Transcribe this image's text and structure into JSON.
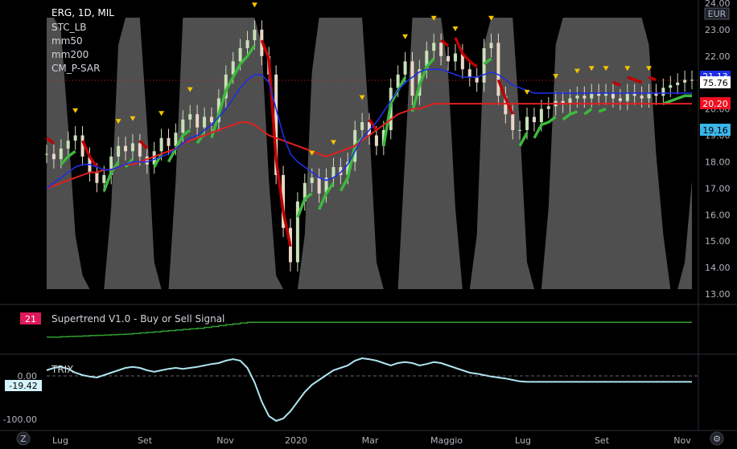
{
  "header": {
    "symbol": "ERG, 1D, MIL",
    "indicators": [
      "STC_LB",
      "mm50",
      "mm200",
      "CM_P-SAR"
    ],
    "currency": "EUR"
  },
  "badges": {
    "price_blue": "21.13",
    "price_white": "75.76",
    "price_red": "20.20",
    "price_cyan": "19.16",
    "supertrend_value": "21",
    "trix_value": "-19.42"
  },
  "colors": {
    "background": "#000000",
    "stc_fill": "#5d5d5d",
    "mm50": "#1e2ee6",
    "mm200": "#e02020",
    "sar_red": "#c00000",
    "sar_green": "#3db83d",
    "supertrend_green": "#2e9e2e",
    "supertrend_red": "#d0205a",
    "trix": "#aee4f0",
    "triangle": "#f5c400"
  },
  "chart_data": [
    {
      "type": "line",
      "panel": "price",
      "y_ticks": [
        "24.00",
        "23.00",
        "22.00",
        "21.00",
        "20.00",
        "19.00",
        "18.00",
        "17.00",
        "16.00",
        "15.00",
        "14.00",
        "13.00"
      ],
      "ylim": [
        13,
        24
      ],
      "x_ticks": [
        "Lug",
        "Set",
        "Nov",
        "2020",
        "Mar",
        "Maggio",
        "Lug",
        "Set",
        "Nov"
      ],
      "series": [
        {
          "key": "close",
          "x": [
            0,
            4,
            8,
            12,
            16,
            20,
            24,
            28,
            32,
            36,
            40,
            44,
            48,
            52,
            56,
            60,
            64,
            68,
            72,
            76,
            80,
            84,
            88,
            92,
            96,
            100,
            104,
            108,
            112,
            116,
            120,
            124,
            128,
            132,
            136,
            140,
            144,
            148,
            152,
            156,
            160,
            164,
            168,
            172,
            176,
            180,
            184,
            188,
            192,
            196,
            200,
            204,
            208,
            212,
            216,
            220,
            224,
            228,
            232,
            236,
            240,
            244,
            248,
            252,
            256,
            260,
            264,
            268,
            272,
            276,
            280,
            284,
            288,
            292,
            296,
            300,
            304,
            308,
            312,
            316,
            320,
            324,
            328,
            332,
            336,
            340,
            344,
            348,
            352,
            356,
            360
          ],
          "values": [
            18.3,
            18.1,
            18.5,
            18.8,
            19.0,
            18.2,
            17.6,
            17.2,
            17.5,
            18.2,
            18.6,
            18.4,
            18.7,
            18.2,
            17.9,
            18.4,
            18.9,
            18.6,
            19.1,
            19.6,
            19.8,
            19.3,
            19.7,
            19.5,
            20.4,
            21.3,
            21.8,
            22.3,
            22.6,
            23.0,
            22.0,
            21.3,
            17.5,
            15.5,
            14.2,
            16.5,
            17.2,
            17.4,
            16.8,
            17.4,
            17.8,
            17.5,
            18.0,
            19.2,
            19.5,
            19.0,
            18.6,
            19.2,
            20.8,
            21.3,
            21.8,
            20.5,
            21.5,
            22.2,
            22.5,
            22.0,
            21.8,
            22.1,
            21.5,
            21.2,
            21.0,
            22.3,
            22.5,
            20.5,
            19.8,
            19.2,
            19.2,
            19.7,
            19.5,
            20.0,
            20.1,
            20.3,
            20.2,
            20.4,
            20.5,
            20.4,
            20.6,
            20.5,
            20.6,
            20.4,
            20.3,
            20.6,
            20.5,
            20.4,
            20.6,
            20.5,
            20.8,
            20.9,
            21.0,
            21.1,
            21.1
          ]
        },
        {
          "key": "mm50",
          "name": "mm50",
          "values": [
            17.0,
            17.2,
            17.4,
            17.6,
            17.8,
            17.9,
            17.9,
            17.8,
            17.7,
            17.7,
            17.8,
            17.9,
            18.0,
            18.0,
            18.0,
            18.1,
            18.2,
            18.3,
            18.5,
            18.7,
            18.9,
            19.0,
            19.2,
            19.4,
            19.7,
            20.0,
            20.4,
            20.8,
            21.1,
            21.3,
            21.3,
            21.0,
            20.0,
            19.0,
            18.3,
            18.0,
            17.8,
            17.6,
            17.4,
            17.3,
            17.4,
            17.6,
            17.9,
            18.4,
            18.9,
            19.2,
            19.5,
            19.9,
            20.3,
            20.7,
            21.0,
            21.2,
            21.4,
            21.5,
            21.5,
            21.5,
            21.4,
            21.3,
            21.2,
            21.2,
            21.2,
            21.3,
            21.4,
            21.3,
            21.1,
            20.9,
            20.8,
            20.7,
            20.6,
            20.6,
            20.6,
            20.6,
            20.6,
            20.6,
            20.6,
            20.6,
            20.6,
            20.6,
            20.6,
            20.6,
            20.6,
            20.6,
            20.6,
            20.6,
            20.6,
            20.6,
            20.6,
            20.6,
            20.6,
            20.6,
            20.6
          ]
        },
        {
          "key": "mm200",
          "name": "mm200",
          "values": [
            17.0,
            17.1,
            17.2,
            17.3,
            17.4,
            17.5,
            17.6,
            17.6,
            17.7,
            17.7,
            17.8,
            17.9,
            17.9,
            18.0,
            18.1,
            18.2,
            18.3,
            18.4,
            18.5,
            18.7,
            18.8,
            18.9,
            19.0,
            19.1,
            19.2,
            19.3,
            19.4,
            19.5,
            19.5,
            19.4,
            19.2,
            19.0,
            18.9,
            18.8,
            18.7,
            18.6,
            18.5,
            18.4,
            18.3,
            18.2,
            18.3,
            18.4,
            18.5,
            18.6,
            18.8,
            19.0,
            19.2,
            19.4,
            19.6,
            19.8,
            19.9,
            20.0,
            20.0,
            20.1,
            20.2,
            20.2,
            20.2,
            20.2,
            20.2,
            20.2,
            20.2,
            20.2,
            20.2,
            20.2,
            20.2,
            20.2,
            20.2,
            20.2,
            20.2,
            20.2,
            20.2,
            20.2,
            20.2,
            20.2,
            20.2,
            20.2,
            20.2,
            20.2,
            20.2,
            20.2,
            20.2,
            20.2,
            20.2,
            20.2,
            20.2,
            20.2,
            20.2,
            20.2,
            20.2,
            20.2,
            20.2
          ]
        },
        {
          "key": "stc",
          "name": "STC_LB",
          "values": [
            100,
            100,
            95,
            60,
            20,
            5,
            0,
            0,
            0,
            30,
            90,
            100,
            100,
            100,
            60,
            10,
            0,
            0,
            40,
            100,
            100,
            100,
            100,
            100,
            100,
            100,
            100,
            100,
            100,
            100,
            90,
            40,
            5,
            0,
            0,
            0,
            20,
            80,
            100,
            100,
            100,
            100,
            100,
            100,
            100,
            60,
            10,
            0,
            0,
            0,
            50,
            100,
            100,
            100,
            100,
            100,
            80,
            30,
            0,
            0,
            20,
            90,
            100,
            100,
            100,
            100,
            60,
            10,
            0,
            0,
            30,
            90,
            100,
            100,
            100,
            100,
            100,
            100,
            100,
            100,
            100,
            100,
            100,
            100,
            90,
            50,
            20,
            0,
            0,
            10,
            40
          ]
        }
      ]
    },
    {
      "type": "line",
      "panel": "supertrend",
      "label": "Supertrend V1.0 - Buy or Sell Signal",
      "series": [
        {
          "key": "st",
          "values": [
            20.0,
            20.0,
            20.1,
            20.2,
            20.3,
            20.4,
            20.5,
            20.6,
            20.7,
            20.8,
            20.9,
            21.0,
            21.2,
            21.4,
            21.6,
            21.8,
            22.0,
            22.2,
            22.4,
            22.6,
            22.8,
            23.0,
            23.3,
            23.6,
            23.9,
            24.2,
            24.5,
            24.8,
            25.0,
            25.0,
            25.0,
            25.0,
            25.0,
            25.0,
            25.0,
            25.0,
            25.0,
            25.0,
            25.0,
            25.0,
            25.0,
            25.0,
            25.0,
            25.0,
            25.0,
            25.0,
            25.0,
            25.0,
            25.0,
            25.0,
            25.0,
            25.0,
            25.0,
            25.0,
            25.0,
            25.0,
            25.0,
            25.0,
            25.0,
            25.0,
            25.0,
            25.0,
            25.0,
            25.0,
            25.0,
            25.0,
            25.0,
            25.0,
            25.0,
            25.0,
            25.0,
            25.0,
            25.0,
            25.0,
            25.0,
            25.0,
            25.0,
            25.0,
            25.0,
            25.0,
            25.0,
            25.0,
            25.0,
            25.0,
            25.0,
            25.0,
            25.0,
            25.0,
            25.0,
            25.0,
            25.0
          ]
        }
      ]
    },
    {
      "type": "line",
      "panel": "trix",
      "label": "TRIX",
      "y_ticks": [
        "0.00",
        "-100.00"
      ],
      "ylim": [
        -110,
        30
      ],
      "series": [
        {
          "key": "trix",
          "values": [
            5,
            10,
            12,
            8,
            0,
            -5,
            -8,
            -10,
            -5,
            0,
            5,
            10,
            12,
            10,
            5,
            2,
            5,
            8,
            10,
            8,
            10,
            12,
            15,
            18,
            20,
            25,
            28,
            25,
            10,
            -20,
            -60,
            -90,
            -100,
            -95,
            -80,
            -60,
            -40,
            -25,
            -15,
            -5,
            5,
            10,
            15,
            25,
            30,
            28,
            25,
            20,
            15,
            20,
            22,
            20,
            15,
            18,
            22,
            20,
            15,
            10,
            5,
            0,
            -2,
            -5,
            -8,
            -10,
            -12,
            -15,
            -18,
            -19,
            -19,
            -19,
            -19,
            -19,
            -19,
            -19,
            -19,
            -19,
            -19,
            -19,
            -19,
            -19,
            -19,
            -19,
            -19,
            -19,
            -19,
            -19,
            -19,
            -19,
            -19,
            -19,
            -19
          ]
        }
      ]
    }
  ]
}
